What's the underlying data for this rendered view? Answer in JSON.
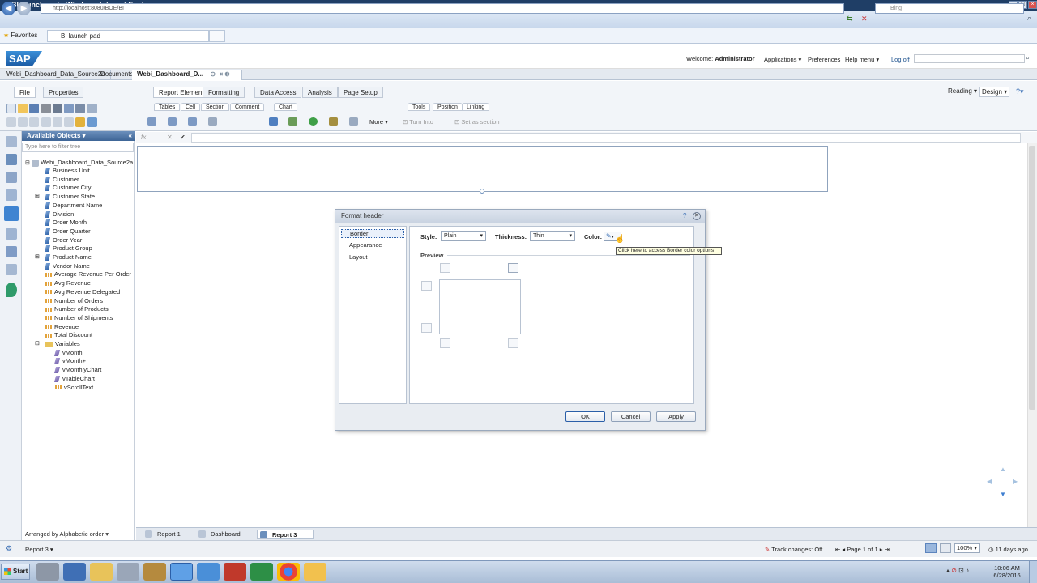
{
  "window": {
    "title": "BI launch pad - Windows Internet Explorer"
  },
  "browser": {
    "address": "http://localhost:8080/BOE/BI",
    "search_placeholder": "Bing",
    "favorites_label": "Favorites",
    "tab_title": "BI launch pad"
  },
  "sap_header": {
    "logo": "SAP",
    "welcome_label": "Welcome:",
    "user": "Administrator",
    "links": [
      "Applications",
      "Preferences",
      "Help menu",
      "Log off"
    ]
  },
  "doc_tabs": [
    "Webi_Dashboard_Data_Source2a",
    "Documents",
    "Webi_Dashboard_D..."
  ],
  "ribbon": {
    "left_tabs": [
      "File",
      "Properties"
    ],
    "main_tabs": [
      "Report Elements",
      "Formatting",
      "Data Access",
      "Analysis",
      "Page Setup"
    ],
    "sub_tabs_left": [
      "Tables",
      "Cell",
      "Section",
      "Comment",
      "Chart"
    ],
    "sub_tabs_right": [
      "Tools",
      "Position",
      "Linking"
    ],
    "more_label": "More",
    "turn_into_label": "Turn Into",
    "set_as_section_label": "Set as section",
    "mode_reading": "Reading",
    "mode_design": "Design"
  },
  "formula_bar": {
    "fx": "fx"
  },
  "available_objects": {
    "title": "Available Objects",
    "filter_placeholder": "Type here to filter tree",
    "root": "Webi_Dashboard_Data_Source2a",
    "dimensions": [
      "Business Unit",
      "Customer",
      "Customer City",
      "Customer State",
      "Department Name",
      "Division",
      "Order Month",
      "Order Quarter",
      "Order Year",
      "Product Group",
      "Product Name",
      "Vendor Name"
    ],
    "measures": [
      "Average Revenue Per Order",
      "Avg Revenue",
      "Avg Revenue Delegated",
      "Number of Orders",
      "Number of Products",
      "Number of Shipments",
      "Revenue",
      "Total Discount"
    ],
    "variables_folder": "Variables",
    "variables": [
      "vMonth",
      "vMonth+",
      "vMonthlyChart",
      "vTableChart",
      "vScrollText"
    ],
    "arranged_by": "Arranged by Alphabetic order"
  },
  "dialog": {
    "title": "Format header",
    "nav": [
      "Border",
      "Appearance",
      "Layout"
    ],
    "style_label": "Style:",
    "style_value": "Plain",
    "thickness_label": "Thickness:",
    "thickness_value": "Thin",
    "color_label": "Color:",
    "tooltip": "Click here to access Border color options",
    "preview_label": "Preview",
    "buttons": {
      "ok": "OK",
      "cancel": "Cancel",
      "apply": "Apply"
    }
  },
  "report_tabs": [
    "Report 1",
    "Dashboard",
    "Report 3"
  ],
  "status_bar": {
    "current_report": "Report 3",
    "track_changes": "Track changes: Off",
    "page": "Page 1 of 1",
    "zoom": "100%",
    "last_refresh": "11 days ago"
  },
  "taskbar": {
    "start": "Start",
    "time": "10:06 AM",
    "date": "6/28/2016"
  }
}
